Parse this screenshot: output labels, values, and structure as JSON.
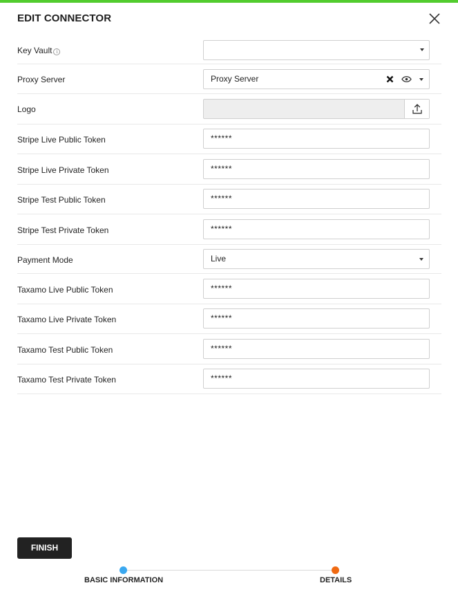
{
  "dialog": {
    "title": "EDIT CONNECTOR",
    "accent_color": "#52cc2e"
  },
  "fields": [
    {
      "label": "Key Vault",
      "type": "select",
      "value": "",
      "has_info": true
    },
    {
      "label": "Proxy Server",
      "type": "select",
      "value": "Proxy Server",
      "clearable": true,
      "viewable": true
    },
    {
      "label": "Logo",
      "type": "file",
      "value": ""
    },
    {
      "label": "Stripe Live Public Token",
      "type": "password",
      "value": "******"
    },
    {
      "label": "Stripe Live Private Token",
      "type": "password",
      "value": "******"
    },
    {
      "label": "Stripe Test Public Token",
      "type": "password",
      "value": "******"
    },
    {
      "label": "Stripe Test Private Token",
      "type": "password",
      "value": "******"
    },
    {
      "label": "Payment Mode",
      "type": "select",
      "value": "Live"
    },
    {
      "label": "Taxamo Live Public Token",
      "type": "password",
      "value": "******"
    },
    {
      "label": "Taxamo Live Private Token",
      "type": "password",
      "value": "******"
    },
    {
      "label": "Taxamo Test Public Token",
      "type": "password",
      "value": "******"
    },
    {
      "label": "Taxamo Test Private Token",
      "type": "password",
      "value": "******"
    }
  ],
  "actions": {
    "finish_label": "FINISH"
  },
  "stepper": {
    "steps": [
      {
        "label": "BASIC INFORMATION",
        "color": "#3aa8f0",
        "state": "completed"
      },
      {
        "label": "DETAILS",
        "color": "#f06a12",
        "state": "current"
      }
    ]
  }
}
